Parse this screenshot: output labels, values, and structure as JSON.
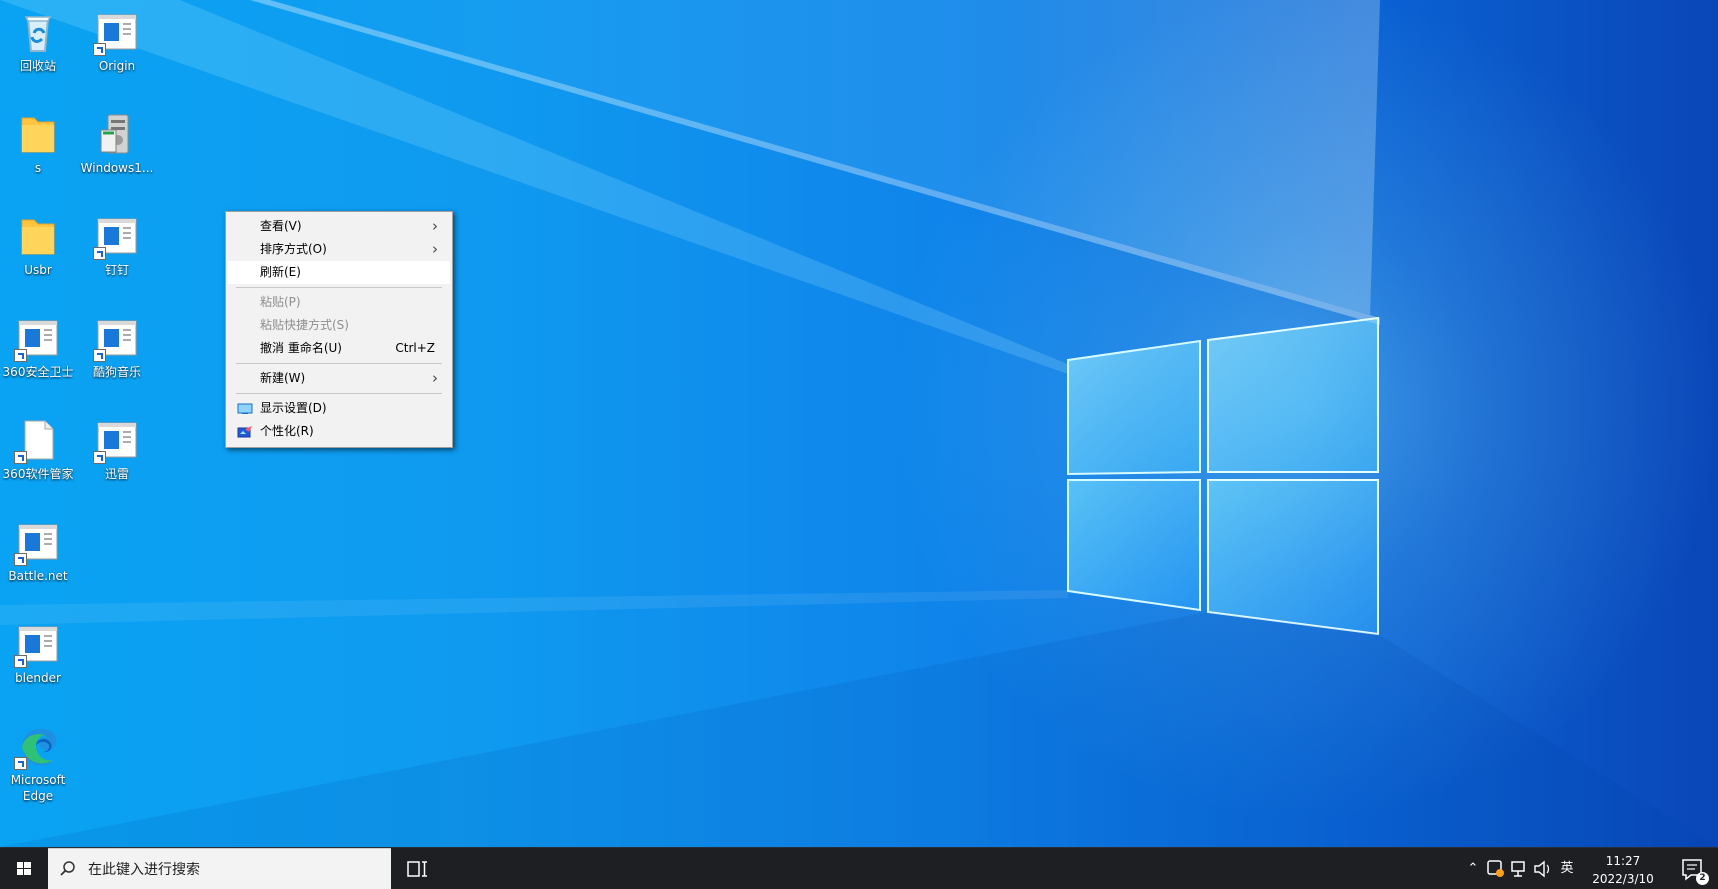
{
  "desktop": {
    "icons": [
      {
        "label": "回收站",
        "icon": "recycle-bin-icon"
      },
      {
        "label": "Origin",
        "icon": "application-shortcut-icon"
      },
      {
        "label": "s",
        "icon": "folder-icon"
      },
      {
        "label": "Windows1...",
        "icon": "installer-package-icon"
      },
      {
        "label": "Usbr",
        "icon": "folder-icon"
      },
      {
        "label": "钉钉",
        "icon": "application-shortcut-icon"
      },
      {
        "label": "360安全卫士",
        "icon": "application-shortcut-icon"
      },
      {
        "label": "酷狗音乐",
        "icon": "application-shortcut-icon"
      },
      {
        "label": "360软件管家",
        "icon": "document-shortcut-icon"
      },
      {
        "label": "迅雷",
        "icon": "application-shortcut-icon"
      },
      {
        "label": "Battle.net",
        "icon": "application-shortcut-icon"
      },
      {
        "label": "blender",
        "icon": "application-shortcut-icon"
      },
      {
        "label": "Microsoft\nEdge",
        "icon": "microsoft-edge-icon"
      }
    ]
  },
  "context_menu": {
    "items": [
      {
        "label": "查看(V)",
        "shortcut": "",
        "submenu": true,
        "disabled": false,
        "icon": ""
      },
      {
        "label": "排序方式(O)",
        "shortcut": "",
        "submenu": true,
        "disabled": false,
        "icon": ""
      },
      {
        "label": "刷新(E)",
        "shortcut": "",
        "submenu": false,
        "disabled": false,
        "icon": "",
        "hovered": true
      },
      {
        "label": "粘贴(P)",
        "shortcut": "",
        "submenu": false,
        "disabled": true,
        "icon": ""
      },
      {
        "label": "粘贴快捷方式(S)",
        "shortcut": "",
        "submenu": false,
        "disabled": true,
        "icon": ""
      },
      {
        "label": "撤消 重命名(U)",
        "shortcut": "Ctrl+Z",
        "submenu": false,
        "disabled": false,
        "icon": ""
      },
      {
        "label": "新建(W)",
        "shortcut": "",
        "submenu": true,
        "disabled": false,
        "icon": ""
      },
      {
        "label": "显示设置(D)",
        "shortcut": "",
        "submenu": false,
        "disabled": false,
        "icon": "display-settings-icon"
      },
      {
        "label": "个性化(R)",
        "shortcut": "",
        "submenu": false,
        "disabled": false,
        "icon": "personalize-icon"
      }
    ]
  },
  "taskbar": {
    "search_placeholder": "在此键入进行搜索",
    "input_language": "英",
    "time": "11:27",
    "date": "2022/3/10",
    "notification_count": "2"
  },
  "colors": {
    "desktop_blue": "#0f8cec",
    "taskbar": "#1d1f23",
    "menu_background": "#f2f2f2",
    "menu_hover": "#ffffff"
  }
}
